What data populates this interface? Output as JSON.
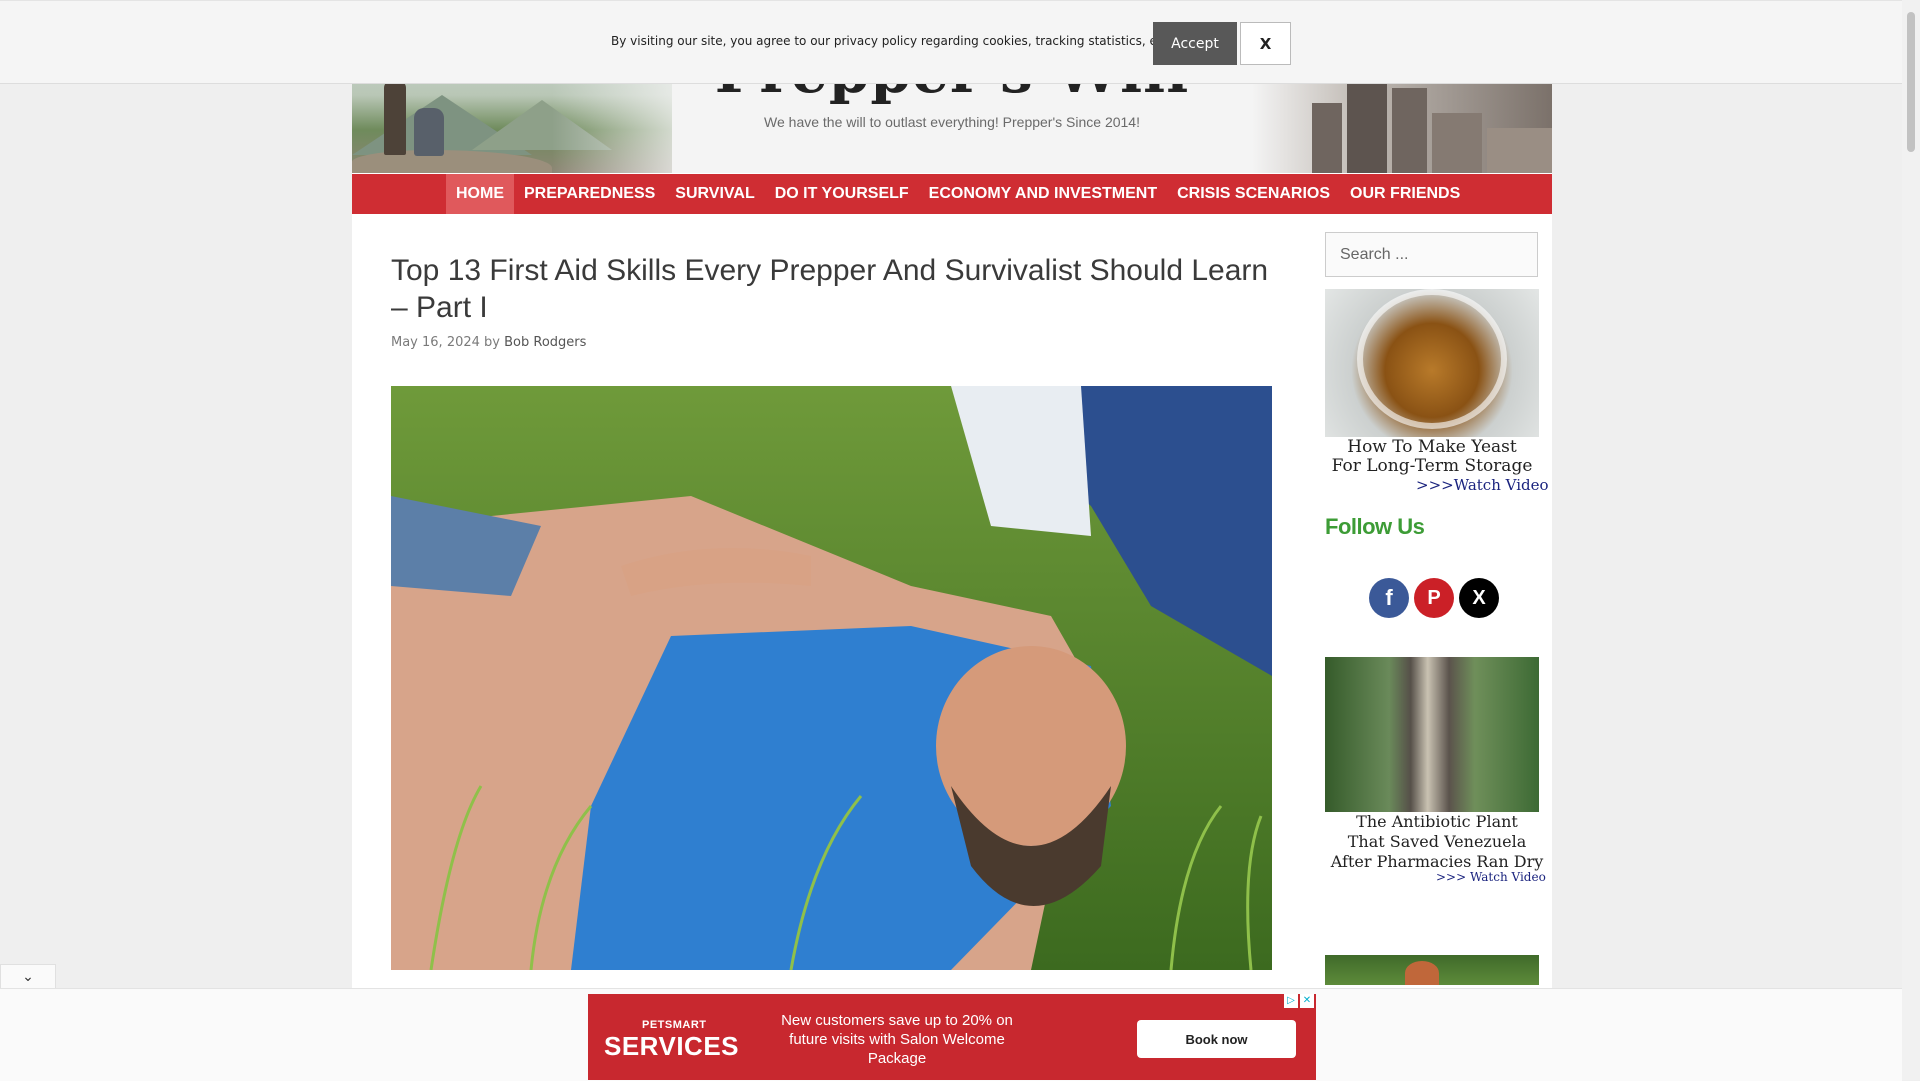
{
  "site": {
    "title": "Prepper's Will",
    "tagline": "We have the will to outlast everything! Prepper's Since 2014!"
  },
  "nav": {
    "items": [
      {
        "label": "HOME",
        "active": true
      },
      {
        "label": "PREPAREDNESS"
      },
      {
        "label": "SURVIVAL"
      },
      {
        "label": "DO IT YOURSELF"
      },
      {
        "label": "ECONOMY AND INVESTMENT"
      },
      {
        "label": "CRISIS SCENARIOS"
      },
      {
        "label": "OUR FRIENDS"
      }
    ]
  },
  "article": {
    "title": "Top 13 First Aid Skills Every Prepper And Survivalist Should Learn – Part I",
    "date": "May 16, 2024",
    "by": "by",
    "author": "Bob Rodgers"
  },
  "sidebar": {
    "search_placeholder": "Search ...",
    "ad1": {
      "line1": "How To Make Yeast",
      "line2": "For Long-Term Storage",
      "link": ">>>Watch Video"
    },
    "follow_title": "Follow Us",
    "social": [
      {
        "name": "facebook",
        "glyph": "f",
        "color": "#3b5998"
      },
      {
        "name": "pinterest",
        "glyph": "P",
        "color": "#cb2027"
      },
      {
        "name": "x",
        "glyph": "X",
        "color": "#000000"
      }
    ],
    "ad2": {
      "line1": "The Antibiotic Plant",
      "line2": "That Saved Venezuela",
      "line3": "After Pharmacies Ran Dry",
      "link": ">>> Watch Video"
    }
  },
  "cookie": {
    "text": "By visiting our site, you agree to our privacy policy regarding cookies, tracking statistics, etc.",
    "accept": "Accept",
    "close": "X"
  },
  "bottom_ad": {
    "brand_small": "PETSMART",
    "brand_big": "SERVICES",
    "text": "New customers save up to 20% on future visits with Salon Welcome Package",
    "cta": "Book now"
  },
  "colors": {
    "nav": "#cf2d33",
    "follow": "#3d9c36",
    "ad": "#c8282f"
  }
}
